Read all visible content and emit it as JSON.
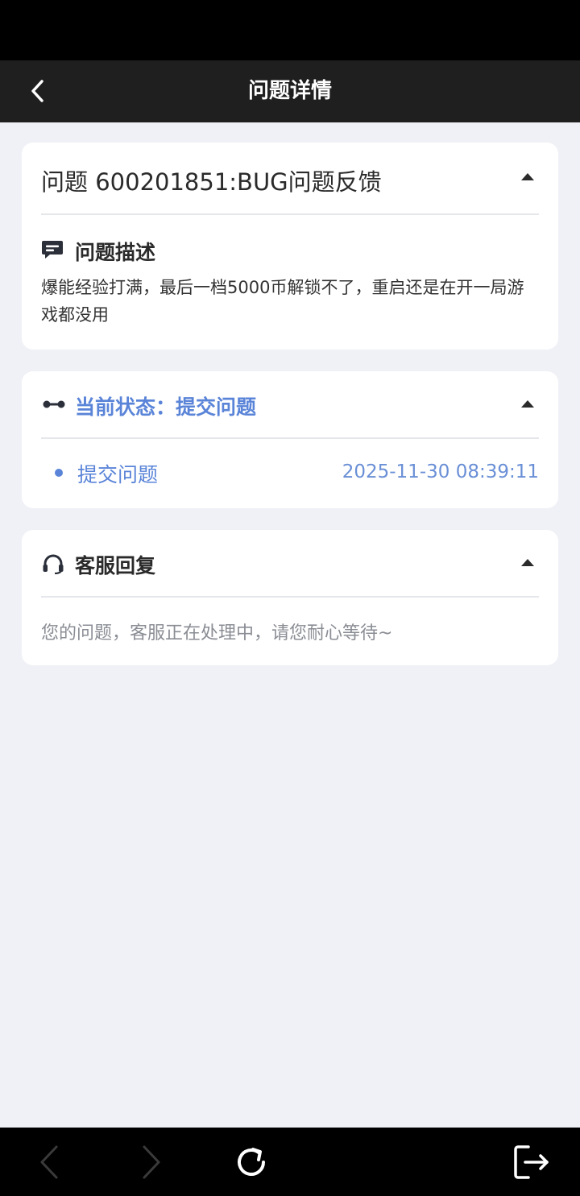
{
  "header": {
    "title": "问题详情"
  },
  "issue": {
    "title": "问题 600201851:BUG问题反馈",
    "description_label": "问题描述",
    "description": "爆能经验打满，最后一档5000币解锁不了，重启还是在开一局游戏都没用"
  },
  "status": {
    "label": "当前状态：提交问题",
    "timeline": [
      {
        "name": "提交问题",
        "time": "2025-11-30 08:39:11"
      }
    ]
  },
  "reply": {
    "label": "客服回复",
    "text": "您的问题，客服正在处理中，请您耐心等待~"
  },
  "colors": {
    "accent": "#5a84d8",
    "header_bg": "#1f1f1f",
    "page_bg": "#f0f1f6"
  },
  "icons": {
    "back": "chevron-left-icon",
    "description": "message-icon",
    "status": "timeline-dots-icon",
    "reply": "headset-icon",
    "collapse": "caret-up-icon",
    "nav_back": "chevron-left-icon",
    "nav_forward": "chevron-right-icon",
    "refresh": "refresh-icon",
    "exit": "exit-icon"
  }
}
